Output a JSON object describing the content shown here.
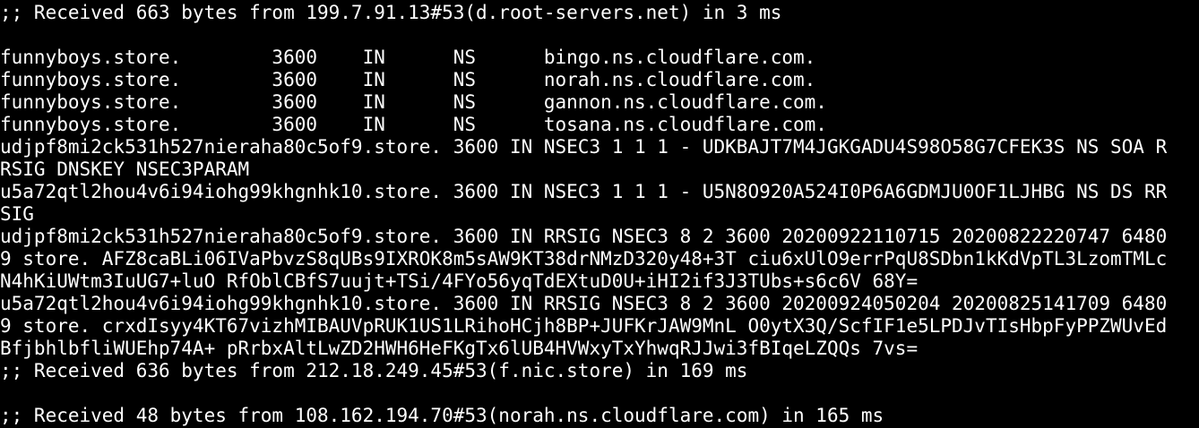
{
  "terminal": {
    "lines": [
      ";; Received 663 bytes from 199.7.91.13#53(d.root-servers.net) in 3 ms",
      "",
      "funnyboys.store.        3600    IN      NS      bingo.ns.cloudflare.com.",
      "funnyboys.store.        3600    IN      NS      norah.ns.cloudflare.com.",
      "funnyboys.store.        3600    IN      NS      gannon.ns.cloudflare.com.",
      "funnyboys.store.        3600    IN      NS      tosana.ns.cloudflare.com.",
      "udjpf8mi2ck531h527nieraha80c5of9.store. 3600 IN NSEC3 1 1 1 - UDKBAJT7M4JGKGADU4S98O58G7CFEK3S NS SOA R",
      "RSIG DNSKEY NSEC3PARAM",
      "u5a72qtl2hou4v6i94iohg99khgnhk10.store. 3600 IN NSEC3 1 1 1 - U5N8O920A524I0P6A6GDMJU0OF1LJHBG NS DS RR",
      "SIG",
      "udjpf8mi2ck531h527nieraha80c5of9.store. 3600 IN RRSIG NSEC3 8 2 3600 20200922110715 20200822220747 6480",
      "9 store. AFZ8caBLi06IVaPbvzS8qUBs9IXROK8m5sAW9KT38drNMzD320y48+3T ciu6xUlO9errPqU8SDbn1kKdVpTL3LzomTMLc",
      "N4hKiUWtm3IuUG7+luO RfOblCBfS7uujt+TSi/4FYo56yqTdEXtuD0U+iHI2if3J3TUbs+s6c6V 68Y=",
      "u5a72qtl2hou4v6i94iohg99khgnhk10.store. 3600 IN RRSIG NSEC3 8 2 3600 20200924050204 20200825141709 6480",
      "9 store. crxdIsyy4KT67vizhMIBAUVpRUK1US1LRihoHCjh8BP+JUFKrJAW9MnL O0ytX3Q/ScfIF1e5LPDJvTIsHbpFyPPZWUvEd",
      "BfjbhlbfliWUEhp74A+ pRrbxAltLwZD2HWH6HeFKgTx6lUB4HVWxyTxYhwqRJJwi3fBIqeLZQQs 7vs=",
      ";; Received 636 bytes from 212.18.249.45#53(f.nic.store) in 169 ms",
      "",
      ";; Received 48 bytes from 108.162.194.70#53(norah.ns.cloudflare.com) in 165 ms"
    ]
  }
}
